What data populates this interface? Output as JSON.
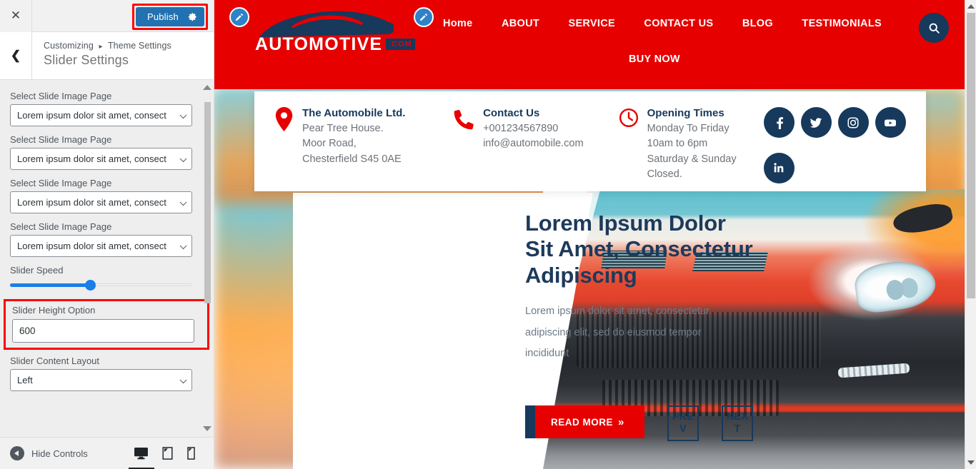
{
  "customizer": {
    "close_icon": "close-icon",
    "publish_label": "Publish",
    "gear_icon": "gear-icon",
    "back_icon": "chevron-left-icon",
    "breadcrumb_root": "Customizing",
    "breadcrumb_sep": "▸",
    "breadcrumb_parent": "Theme Settings",
    "panel_title": "Slider Settings",
    "accent_blue": "#2271b1",
    "highlight_red": "#ff0000",
    "controls": [
      {
        "label": "Select Slide Image Page",
        "type": "select",
        "value": "Lorem ipsum dolor sit amet, consect"
      },
      {
        "label": "Select Slide Image Page",
        "type": "select",
        "value": "Lorem ipsum dolor sit amet, consect"
      },
      {
        "label": "Select Slide Image Page",
        "type": "select",
        "value": "Lorem ipsum dolor sit amet, consect"
      },
      {
        "label": "Select Slide Image Page",
        "type": "select",
        "value": "Lorem ipsum dolor sit amet, consect"
      },
      {
        "label": "Slider Speed",
        "type": "range",
        "value": 44
      },
      {
        "label": "Slider Height Option",
        "type": "text",
        "value": "600",
        "highlighted": true
      },
      {
        "label": "Slider Content Layout",
        "type": "select",
        "value": "Left"
      }
    ],
    "footer": {
      "hide_controls_label": "Hide Controls",
      "devices": [
        "desktop-icon",
        "tablet-icon",
        "mobile-icon"
      ],
      "active_device": "desktop-icon"
    }
  },
  "site": {
    "brand": {
      "word": "AUTOMOTIVE",
      "suffix": ".COM",
      "car_icon": "car-silhouette-icon"
    },
    "header": {
      "bg": "#e60000",
      "nav_row1": [
        "Home",
        "ABOUT",
        "SERVICE",
        "CONTACT US",
        "BLOG",
        "TESTIMONIALS"
      ],
      "nav_row2": [
        "BUY NOW"
      ],
      "search_icon": "search-icon",
      "edit_pencil_icon": "edit-pencil-icon"
    },
    "info_card": {
      "address": {
        "icon": "map-pin-icon",
        "title": "The Automobile Ltd.",
        "lines": [
          "Pear Tree House.",
          "Moor Road,",
          "Chesterfield S45 0AE"
        ]
      },
      "contact": {
        "icon": "phone-icon",
        "title": "Contact Us",
        "lines": [
          "+001234567890",
          "info@automobile.com"
        ]
      },
      "hours": {
        "icon": "clock-icon",
        "title": "Opening Times",
        "lines": [
          "Monday To Friday",
          "10am to 6pm",
          "Saturday & Sunday",
          "Closed."
        ]
      },
      "socials": [
        "facebook-icon",
        "twitter-icon",
        "instagram-icon",
        "youtube-icon",
        "linkedin-icon"
      ]
    },
    "slider": {
      "heading": "Lorem Ipsum Dolor Sit Amet, Consectetur Adipiscing",
      "paragraph": "Lorem ipsum dolor sit amet, consectetur adipiscing elit, sed do eiusmod tempor incididunt",
      "read_more_label": "READ MORE",
      "read_more_icon": "double-chevron-right-icon",
      "prev_label": "PREV",
      "next_label": "NEXT",
      "navy": "#16395c",
      "red": "#e60000"
    }
  }
}
